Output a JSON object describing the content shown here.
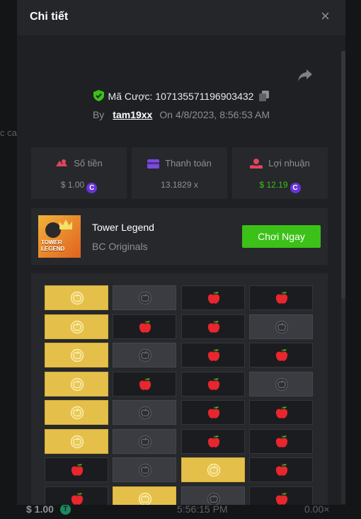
{
  "background": {
    "side_text": "c ca",
    "bottom_amount": "$ 1.00",
    "bottom_coin": "T",
    "bottom_time": "5:56:15 PM",
    "bottom_multiplier": "0.00×"
  },
  "modal": {
    "title": "Chi tiết",
    "close_label": "×"
  },
  "bet": {
    "id_label": "Mã Cược:",
    "id_value": "107135571196903432",
    "by_label": "By",
    "username": "tam19xx",
    "on_label": "On",
    "datetime": "4/8/2023, 8:56:53 AM"
  },
  "stats": {
    "amount": {
      "label": "Số tiền",
      "value": "$ 1.00",
      "icon": "bet-amount-icon"
    },
    "payout": {
      "label": "Thanh toán",
      "value": "13.1829 x",
      "icon": "wallet-icon"
    },
    "profit": {
      "label": "Lợi nhuận",
      "value": "$ 12.19",
      "icon": "profit-icon"
    },
    "currency_symbol": "C"
  },
  "game": {
    "name": "Tower Legend",
    "provider": "BC Originals",
    "thumb_text": "TOWER LEGEND",
    "play_label": "Chơi Ngay"
  },
  "colors": {
    "accent_green": "#3bc117",
    "coin_purple": "#6a33d8",
    "gold_cell": "#e4c04b"
  },
  "board": {
    "rows": [
      [
        "gold",
        "dark",
        "apple",
        "apple"
      ],
      [
        "gold",
        "apple",
        "apple",
        "dark"
      ],
      [
        "gold",
        "dark",
        "apple",
        "apple"
      ],
      [
        "gold",
        "apple",
        "apple",
        "dark"
      ],
      [
        "gold",
        "dark",
        "apple",
        "apple"
      ],
      [
        "gold",
        "dark",
        "apple",
        "apple"
      ],
      [
        "apple",
        "dark",
        "gold",
        "apple"
      ],
      [
        "apple",
        "gold",
        "dark",
        "apple"
      ]
    ]
  }
}
